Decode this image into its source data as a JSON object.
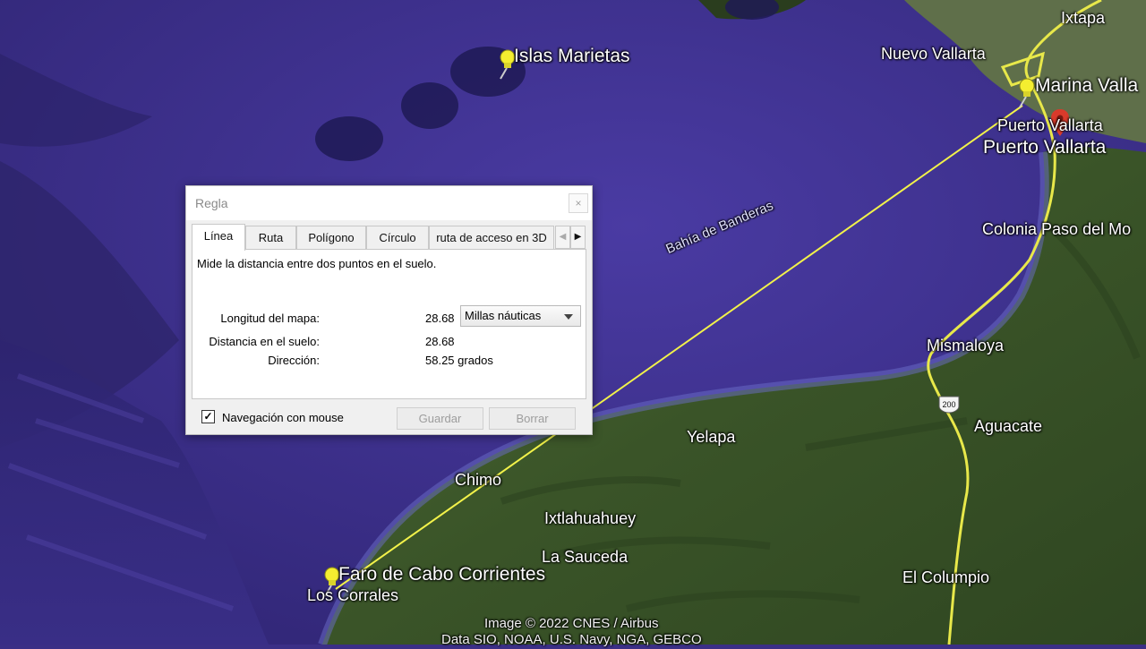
{
  "map": {
    "labels": {
      "islas_marietas": "Islas Marietas",
      "nuevo_vallarta": "Nuevo Vallarta",
      "ixtapa": "Ixtapa",
      "marina_vallarta": "Marina Valla",
      "puerto_vallarta_1": "Puerto Vallarta",
      "puerto_vallarta_2": "Puerto Vallarta",
      "bahia": "Bahía de Banderas",
      "colonia": "Colonia Paso del Mo",
      "mismaloya": "Mismaloya",
      "aguacate": "Aguacate",
      "yelapa": "Yelapa",
      "chimo": "Chimo",
      "ixtlahuahuey": "Ixtlahuahuey",
      "la_sauceda": "La Sauceda",
      "faro": "Faro de Cabo Corrientes",
      "los_corrales": "Los Corrales",
      "el_columpio": "El Columpio",
      "highway": "200",
      "credit_image": "Image © 2022 CNES / Airbus",
      "credit_data": "Data SIO, NOAA, U.S. Navy, NGA, GEBCO"
    },
    "colors": {
      "ocean": "#3b2f86",
      "land": "#3f5a2c",
      "measure_line": "#f2f24a",
      "pin": "#f4ee30",
      "location_marker": "#d93a2b"
    }
  },
  "dialog": {
    "title": "Regla",
    "close_icon": "×",
    "tabs": [
      "Línea",
      "Ruta",
      "Polígono",
      "Círculo",
      "ruta de acceso en 3D"
    ],
    "active_tab": "Línea",
    "tab_prev": "◀",
    "tab_next": "▶",
    "description": "Mide la distancia entre dos puntos en el suelo.",
    "map_length_label": "Longitud del mapa:",
    "map_length_value": "28.68",
    "unit": "Millas náuticas",
    "ground_distance_label": "Distancia en el suelo:",
    "ground_distance_value": "28.68",
    "heading_label": "Dirección:",
    "heading_value": "58.25 grados",
    "mouse_nav_checked": true,
    "mouse_nav_check": "✓",
    "mouse_nav_label": "Navegación con mouse",
    "save_label": "Guardar",
    "clear_label": "Borrar"
  }
}
